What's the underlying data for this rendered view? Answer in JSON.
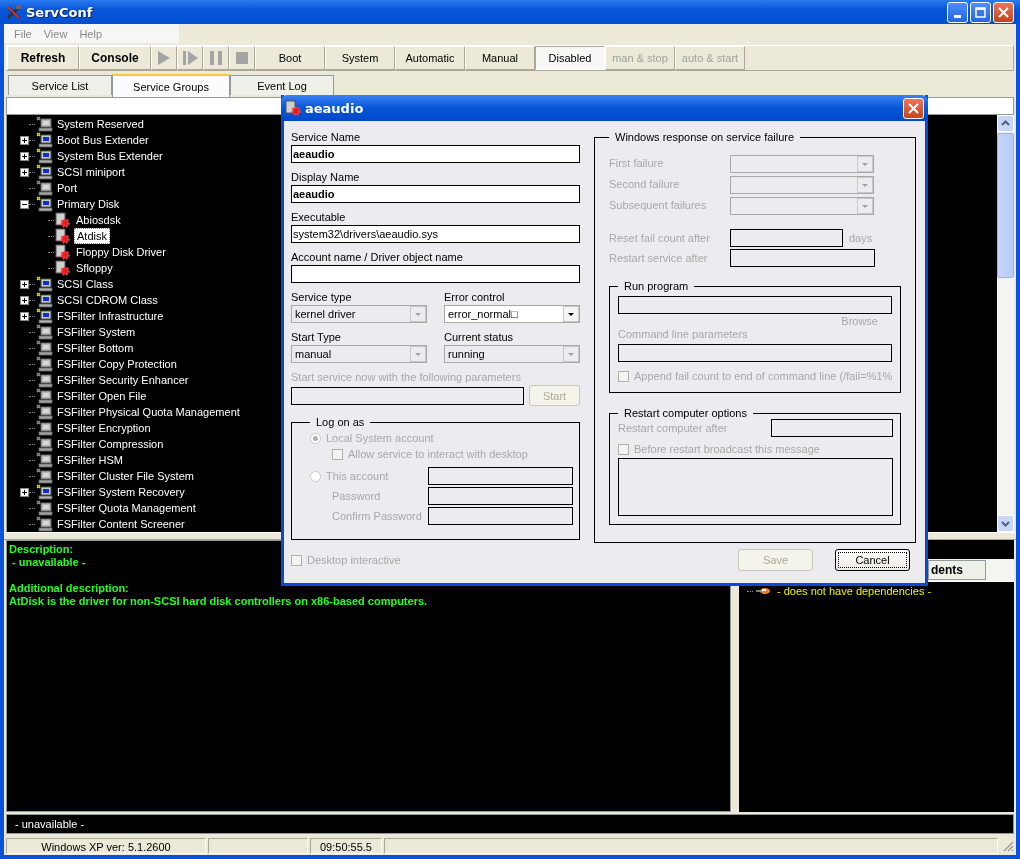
{
  "window": {
    "title": "ServConf"
  },
  "menu": [
    "File",
    "View",
    "Help"
  ],
  "toolbar": [
    {
      "kind": "command",
      "label": "Refresh"
    },
    {
      "kind": "command",
      "label": "Console"
    },
    {
      "kind": "play",
      "disabled": true
    },
    {
      "kind": "step",
      "disabled": true
    },
    {
      "kind": "pause",
      "disabled": true
    },
    {
      "kind": "stop",
      "disabled": true
    },
    {
      "kind": "filter",
      "label": "Boot",
      "selected": false,
      "disabled": false
    },
    {
      "kind": "filter",
      "label": "System",
      "selected": false,
      "disabled": false
    },
    {
      "kind": "filter",
      "label": "Automatic",
      "selected": false,
      "disabled": false
    },
    {
      "kind": "filter",
      "label": "Manual",
      "selected": false,
      "disabled": false
    },
    {
      "kind": "filter",
      "label": "Disabled",
      "selected": true,
      "disabled": false
    },
    {
      "kind": "filter",
      "label": "man & stop",
      "selected": false,
      "disabled": true
    },
    {
      "kind": "filter",
      "label": "auto & start",
      "selected": false,
      "disabled": true
    }
  ],
  "tabs": [
    {
      "label": "Service List",
      "selected": false
    },
    {
      "label": "Service Groups",
      "selected": true
    },
    {
      "label": "Event Log",
      "selected": false
    }
  ],
  "tree": [
    {
      "label": "System Reserved",
      "kind": "empty-group",
      "selected": false
    },
    {
      "label": "Boot Bus Extender",
      "kind": "group",
      "expanded": false,
      "selected": false
    },
    {
      "label": "System Bus Extender",
      "kind": "group",
      "expanded": false,
      "selected": false
    },
    {
      "label": "SCSI miniport",
      "kind": "group",
      "expanded": false,
      "selected": false
    },
    {
      "label": "Port",
      "kind": "empty-group",
      "selected": false
    },
    {
      "label": "Primary Disk",
      "kind": "group",
      "expanded": true,
      "selected": false,
      "children": [
        {
          "label": "Abiosdsk",
          "kind": "service",
          "selected": false
        },
        {
          "label": "Atdisk",
          "kind": "service",
          "selected": true
        },
        {
          "label": "Floppy Disk Driver",
          "kind": "service",
          "selected": false
        },
        {
          "label": "Sfloppy",
          "kind": "service",
          "selected": false
        }
      ]
    },
    {
      "label": "SCSI Class",
      "kind": "group",
      "expanded": false,
      "selected": false
    },
    {
      "label": "SCSI CDROM Class",
      "kind": "group",
      "expanded": false,
      "selected": false
    },
    {
      "label": "FSFilter Infrastructure",
      "kind": "group",
      "expanded": false,
      "selected": false
    },
    {
      "label": "FSFilter System",
      "kind": "empty-group",
      "selected": false
    },
    {
      "label": "FSFilter Bottom",
      "kind": "empty-group",
      "selected": false
    },
    {
      "label": "FSFilter Copy Protection",
      "kind": "empty-group",
      "selected": false
    },
    {
      "label": "FSFilter Security Enhancer",
      "kind": "empty-group",
      "selected": false
    },
    {
      "label": "FSFilter Open File",
      "kind": "empty-group",
      "selected": false
    },
    {
      "label": "FSFilter Physical Quota Management",
      "kind": "empty-group",
      "selected": false
    },
    {
      "label": "FSFilter Encryption",
      "kind": "empty-group",
      "selected": false
    },
    {
      "label": "FSFilter Compression",
      "kind": "empty-group",
      "selected": false
    },
    {
      "label": "FSFilter HSM",
      "kind": "empty-group",
      "selected": false
    },
    {
      "label": "FSFilter Cluster File System",
      "kind": "empty-group",
      "selected": false
    },
    {
      "label": "FSFilter System Recovery",
      "kind": "group",
      "expanded": false,
      "selected": false
    },
    {
      "label": "FSFilter Quota Management",
      "kind": "empty-group",
      "selected": false
    },
    {
      "label": "FSFilter Content Screener",
      "kind": "empty-group",
      "selected": false
    }
  ],
  "description": [
    {
      "heading": "Description:",
      "text": " - unavailable -"
    },
    {
      "heading": "Additional description:",
      "text": "AtDisk is the driver for non-SCSI hard disk controllers on x86-based computers."
    }
  ],
  "dependencies": {
    "button": "dents",
    "items": [
      "- does not have dependencies -"
    ]
  },
  "status_line": "- unavailable -",
  "status_bar": [
    {
      "kind": "text",
      "text": "Windows XP ver: 5.1.2600"
    },
    {
      "kind": "empty"
    },
    {
      "kind": "text",
      "text": "09:50:55.5"
    },
    {
      "kind": "empty"
    }
  ],
  "dialog": {
    "title": "aeaudio",
    "service_name": {
      "label": "Service Name",
      "value": "aeaudio"
    },
    "display_name": {
      "label": "Display Name",
      "value": "aeaudio"
    },
    "executable": {
      "label": "Executable",
      "value": "system32\\drivers\\aeaudio.sys"
    },
    "account_name": {
      "label": "Account name / Driver object name"
    },
    "service_type": {
      "label": "Service type",
      "value": "kernel driver",
      "disabled": true
    },
    "error_control": {
      "label": "Error control",
      "value": "error_normal□",
      "disabled": false
    },
    "start_type": {
      "label": "Start Type",
      "value": "manual",
      "disabled": true
    },
    "current_status": {
      "label": "Current status",
      "value": "running",
      "disabled": true
    },
    "start_params": {
      "label": "Start service now with the following parameters",
      "button": "Start",
      "disabled": true
    },
    "logon": {
      "title": "Log on as",
      "disabled": true,
      "options": [
        {
          "label": "Local System account",
          "selected": true
        },
        {
          "label": "This account",
          "selected": false
        }
      ],
      "interact": {
        "label": "Allow service to interact with desktop",
        "checked": false
      },
      "password": "Password",
      "confirm": "Confirm Password"
    },
    "desktop_interactive": {
      "label": "Desktop interactive",
      "checked": false,
      "disabled": true
    },
    "failure": {
      "title": "Windows response on service failure",
      "disabled": true,
      "rows": [
        "First failure",
        "Second failure",
        "Subsequent failures"
      ],
      "reset": {
        "label": "Reset fail count after",
        "unit": "days"
      },
      "restart_service": "Restart service after",
      "run_program": {
        "title": "Run program",
        "browse": "Browse",
        "params": "Command line parameters",
        "append": {
          "label": "Append fail count to end of command line (/fail=%1%",
          "checked": false
        }
      },
      "restart_computer": {
        "title": "Restart computer options",
        "after": "Restart computer after",
        "broadcast": {
          "label": "Before restart broadcast this message",
          "checked": false
        }
      }
    },
    "buttons": [
      {
        "label": "Save",
        "disabled": true,
        "focused": false
      },
      {
        "label": "Cancel",
        "disabled": false,
        "focused": true
      }
    ]
  }
}
